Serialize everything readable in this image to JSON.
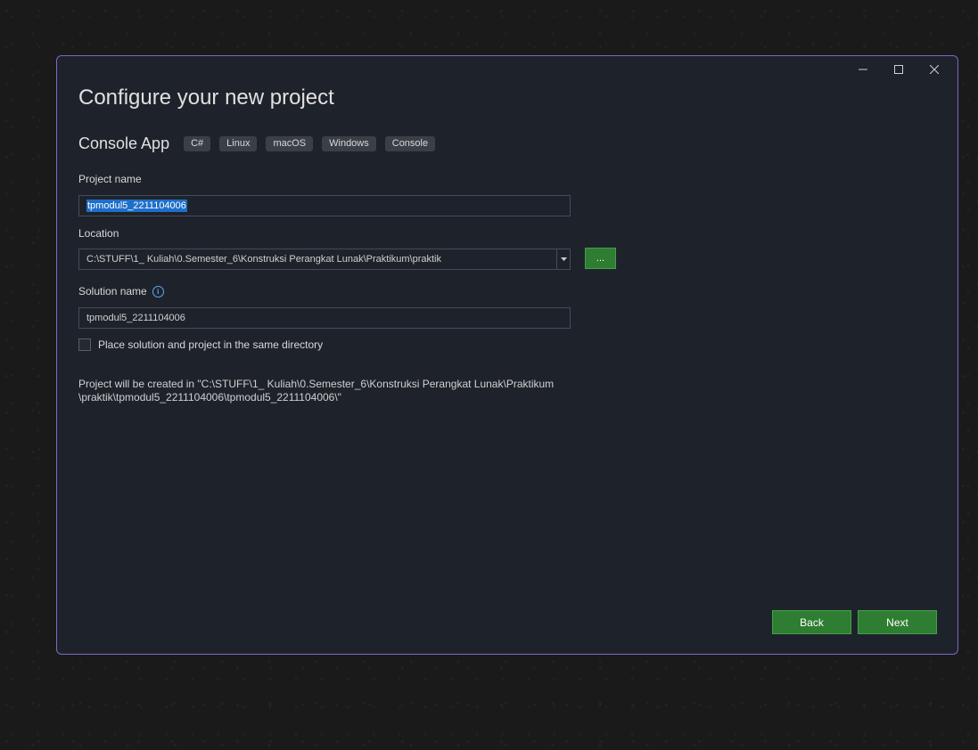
{
  "window": {
    "controls": {
      "minimize": "minimize-icon",
      "maximize": "maximize-icon",
      "close": "close-icon"
    }
  },
  "dialog": {
    "title": "Configure your new project",
    "template_name": "Console App",
    "tags": [
      "C#",
      "Linux",
      "macOS",
      "Windows",
      "Console"
    ]
  },
  "project_name": {
    "label": "Project name",
    "value": "tpmodul5_2211104006"
  },
  "location": {
    "label": "Location",
    "value": "C:\\STUFF\\1_ Kuliah\\0.Semester_6\\Konstruksi Perangkat Lunak\\Praktikum\\praktik",
    "browse_label": "..."
  },
  "solution_name": {
    "label": "Solution name",
    "info_icon": "i",
    "value": "tpmodul5_2211104006"
  },
  "same_directory": {
    "label": "Place solution and project in the same directory",
    "checked": false
  },
  "path_note": {
    "line1": "Project will be created in \"C:\\STUFF\\1_ Kuliah\\0.Semester_6\\Konstruksi Perangkat Lunak\\Praktikum",
    "line2": "\\praktik\\tpmodul5_2211104006\\tpmodul5_2211104006\\\""
  },
  "buttons": {
    "back": "Back",
    "next": "Next"
  },
  "colors": {
    "accent_button": "#2e7d32",
    "border_accent": "#7a68c8",
    "selection": "#1e6fc9"
  }
}
